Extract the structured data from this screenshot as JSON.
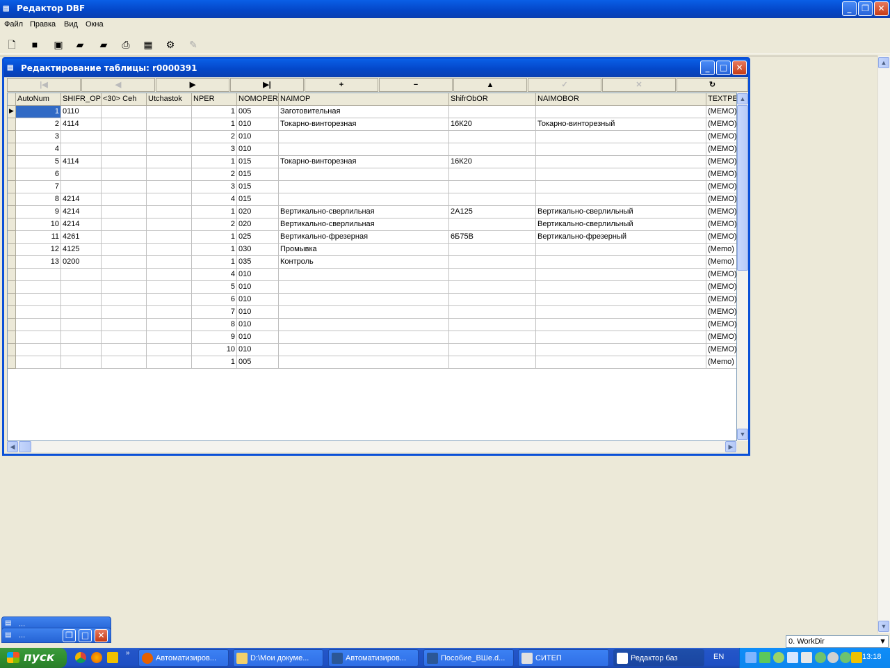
{
  "app": {
    "title": "Редактор DBF"
  },
  "menu": [
    "Файл",
    "Правка",
    "Вид",
    "Окна"
  ],
  "toolbar": {
    "icons": [
      "new-file-icon",
      "save-icon",
      "save-all-icon",
      "open-folder-icon",
      "open-folder-star-icon",
      "print-icon",
      "table-icon",
      "settings-icon",
      "edit-icon"
    ]
  },
  "child": {
    "title": "Редактирование таблицы: r0000391"
  },
  "navigator": [
    "|◀",
    "◀",
    "▶",
    "▶|",
    "+",
    "−",
    "▲",
    "✓",
    "✕",
    "↻"
  ],
  "grid": {
    "columns": [
      "AutoNum",
      "SHIFR_OP",
      "<30> Ceh",
      "Utchastok",
      "NPER",
      "NOMOPER",
      "NAIMOP",
      "ShifrObOR",
      "NAIMOBOR",
      "TEXTPE"
    ],
    "rows": [
      [
        "1",
        "0110",
        "",
        "",
        "1",
        "005",
        "Заготовительная",
        "",
        "",
        "(MEMO)"
      ],
      [
        "2",
        "4114",
        "",
        "",
        "1",
        "010",
        "Токарно-винторезная",
        "16К20",
        "Токарно-винторезный",
        "(MEMO)"
      ],
      [
        "3",
        "",
        "",
        "",
        "2",
        "010",
        "",
        "",
        "",
        "(MEMO)"
      ],
      [
        "4",
        "",
        "",
        "",
        "3",
        "010",
        "",
        "",
        "",
        "(MEMO)"
      ],
      [
        "5",
        "4114",
        "",
        "",
        "1",
        "015",
        "Токарно-винторезная",
        "16К20",
        "",
        "(MEMO)"
      ],
      [
        "6",
        "",
        "",
        "",
        "2",
        "015",
        "",
        "",
        "",
        "(MEMO)"
      ],
      [
        "7",
        "",
        "",
        "",
        "3",
        "015",
        "",
        "",
        "",
        "(MEMO)"
      ],
      [
        "8",
        "4214",
        "",
        "",
        "4",
        "015",
        "",
        "",
        "",
        "(MEMO)"
      ],
      [
        "9",
        "4214",
        "",
        "",
        "1",
        "020",
        "Вертикально-сверлильная",
        "2А125",
        "Вертикально-сверлильный",
        "(MEMO)"
      ],
      [
        "10",
        "4214",
        "",
        "",
        "2",
        "020",
        "Вертикально-сверлильная",
        "",
        "Вертикально-сверлильный",
        "(MEMO)"
      ],
      [
        "11",
        "4261",
        "",
        "",
        "1",
        "025",
        "Вертикально-фрезерная",
        "6Б75В",
        "Вертикально-фрезерный",
        "(MEMO)"
      ],
      [
        "12",
        "4125",
        "",
        "",
        "1",
        "030",
        "Промывка",
        "",
        "",
        "(Memo)"
      ],
      [
        "13",
        "0200",
        "",
        "",
        "1",
        "035",
        "Контроль",
        "",
        "",
        "(Memo)"
      ],
      [
        "",
        "",
        "",
        "",
        "4",
        "010",
        "",
        "",
        "",
        "(MEMO)"
      ],
      [
        "",
        "",
        "",
        "",
        "5",
        "010",
        "",
        "",
        "",
        "(MEMO)"
      ],
      [
        "",
        "",
        "",
        "",
        "6",
        "010",
        "",
        "",
        "",
        "(MEMO)"
      ],
      [
        "",
        "",
        "",
        "",
        "7",
        "010",
        "",
        "",
        "",
        "(MEMO)"
      ],
      [
        "",
        "",
        "",
        "",
        "8",
        "010",
        "",
        "",
        "",
        "(MEMO)"
      ],
      [
        "",
        "",
        "",
        "",
        "9",
        "010",
        "",
        "",
        "",
        "(MEMO)"
      ],
      [
        "",
        "",
        "",
        "",
        "10",
        "010",
        "",
        "",
        "",
        "(MEMO)"
      ],
      [
        "",
        "",
        "",
        "",
        "1",
        "005",
        "",
        "",
        "",
        "(Memo)"
      ]
    ]
  },
  "minimized": [
    {
      "title": "..."
    },
    {
      "title": "..."
    }
  ],
  "status": {
    "workdir": "0. WorkDir"
  },
  "taskbar": {
    "start": "пуск",
    "buttons": [
      "Автоматизиров...",
      "D:\\Мои докуме...",
      "Автоматизиров...",
      "Пособие_ВШе.d...",
      "СИТЕП",
      "Редактор баз"
    ],
    "lang": "EN",
    "clock": "13:18"
  },
  "colors": {
    "xp_blue": "#0a50d8",
    "start_green": "#2f8f2f",
    "face": "#ece9d8"
  }
}
